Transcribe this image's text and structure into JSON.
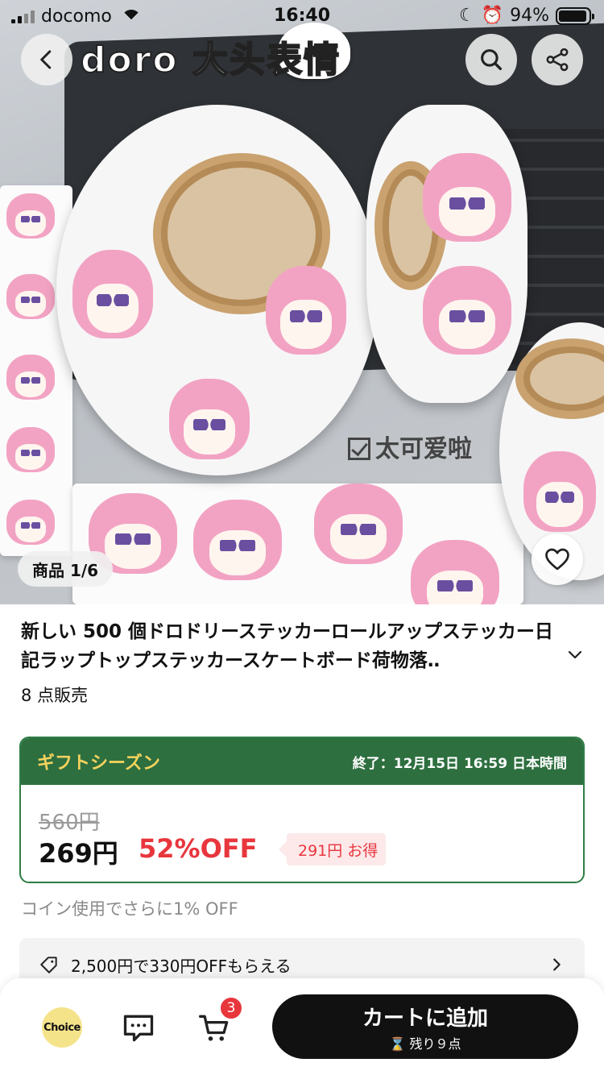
{
  "status_bar": {
    "carrier": "docomo",
    "time": "16:40",
    "battery": "94%",
    "battery_level": 0.94
  },
  "hero": {
    "overlay_title": "doro 大头表情",
    "caption": "太可爱啦",
    "image_counter": "商品 1/6"
  },
  "product": {
    "title": "新しい 500 個ドロドリーステッカーロールアップステッカー日記ラップトップステッカースケートボード荷物落‥",
    "sold": "8 点販売"
  },
  "promo": {
    "name": "ギフトシーズン",
    "end": "終了：12月15日 16:59 日本時間",
    "original_price": "560円",
    "price": "269円",
    "discount": "52%OFF",
    "savings": "291円 お得",
    "header_color": "#2e6f3f",
    "accent_color": "#e8363d"
  },
  "coin_note": "コイン使用でさらに1% OFF",
  "coupon": {
    "text": "2,500円で330円OFFもらえる"
  },
  "bottom_bar": {
    "choice_label": "Choice",
    "cart_count": "3",
    "add_to_cart": "カートに追加",
    "stock_note": "残り９点"
  },
  "icons": {
    "back": "chevron-left-icon",
    "search": "search-icon",
    "share": "share-icon",
    "favorite": "heart-icon",
    "expand": "chevron-down-icon",
    "coupon": "tag-icon",
    "coupon_go": "chevron-right-icon",
    "message": "message-icon",
    "cart": "cart-icon",
    "stock": "hourglass-icon"
  }
}
